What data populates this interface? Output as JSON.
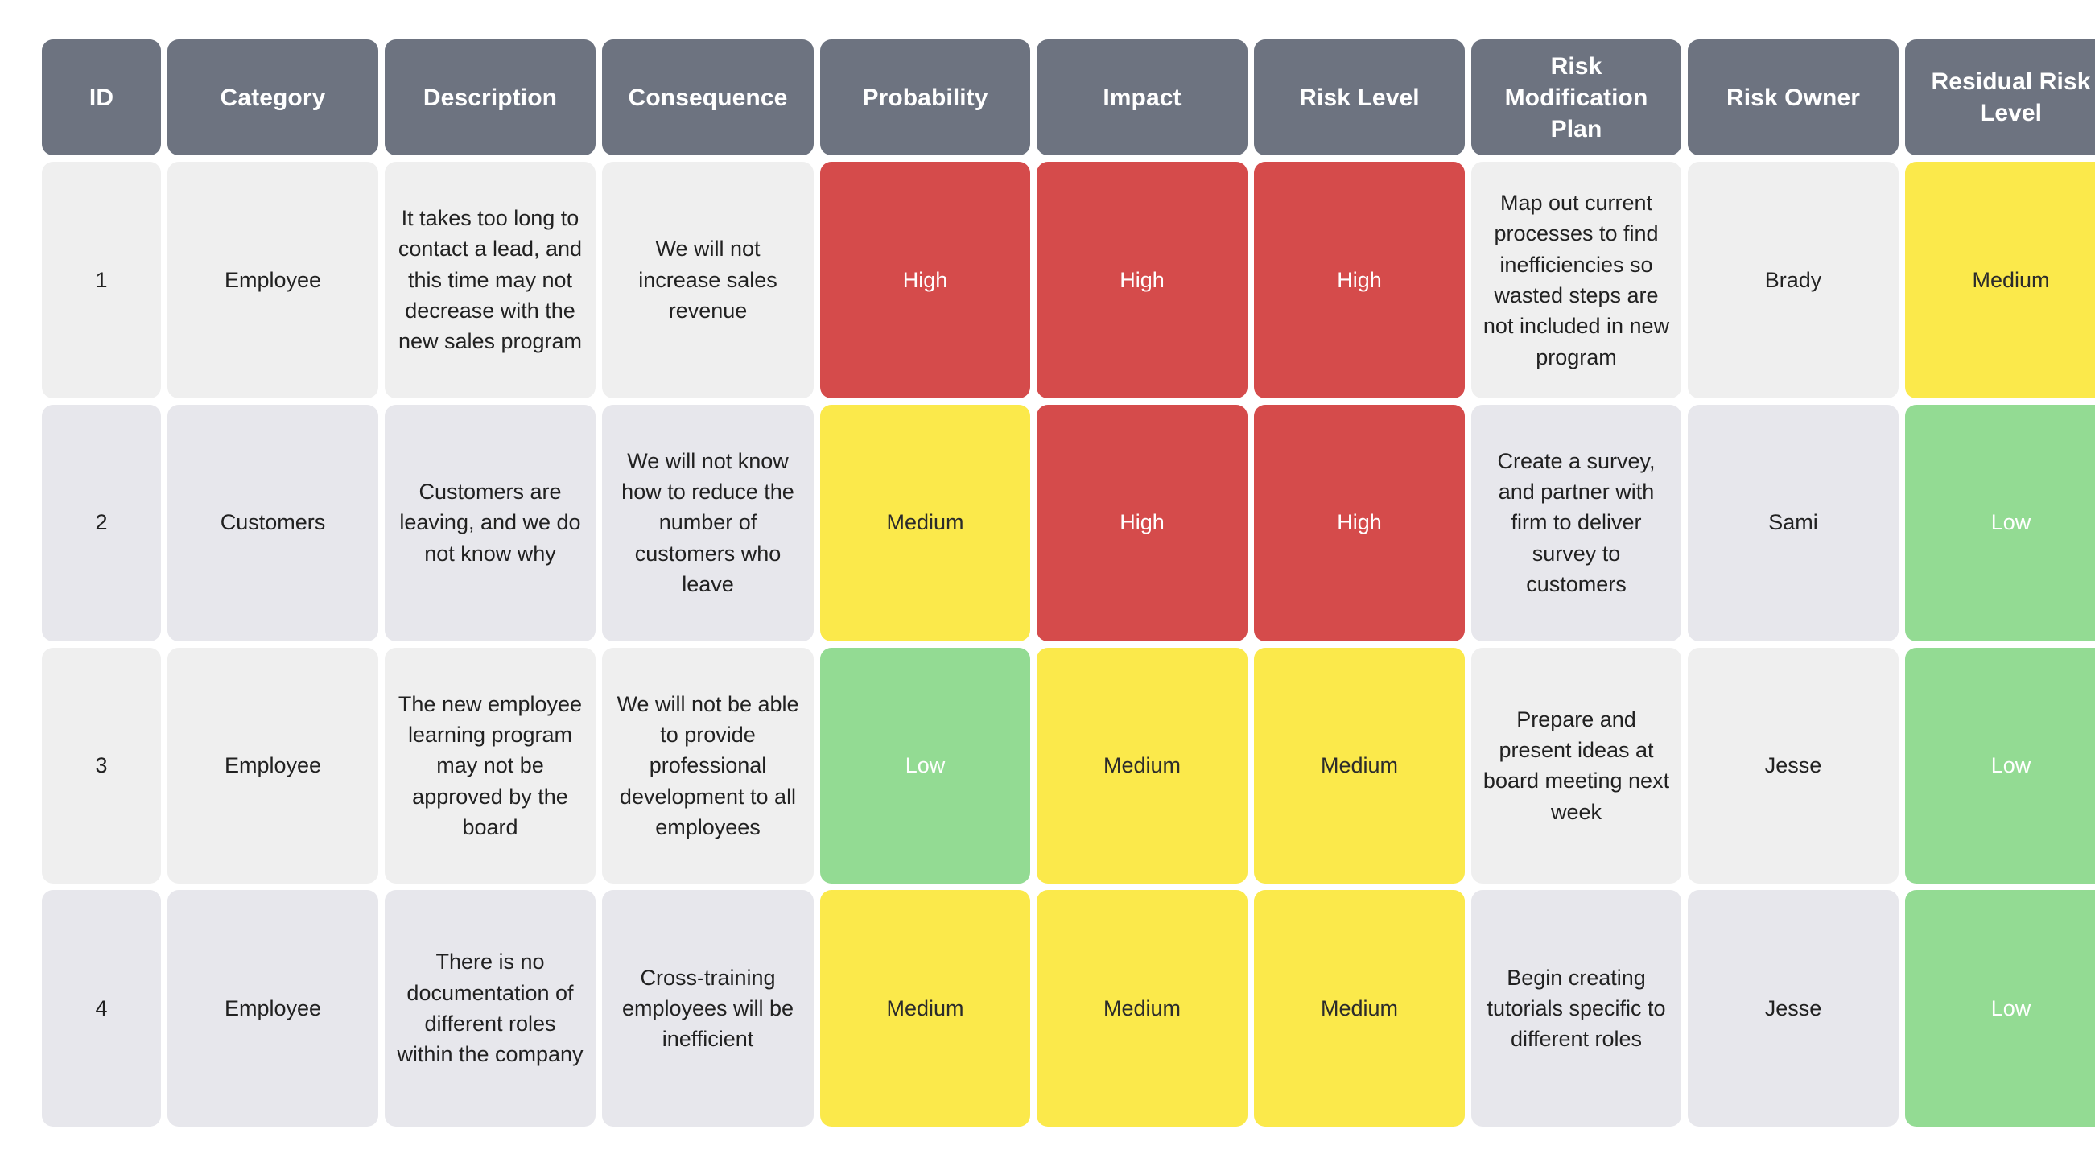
{
  "table": {
    "columns": [
      {
        "key": "id",
        "label": "ID"
      },
      {
        "key": "category",
        "label": "Category"
      },
      {
        "key": "description",
        "label": "Description"
      },
      {
        "key": "consequence",
        "label": "Consequence"
      },
      {
        "key": "probability",
        "label": "Probability"
      },
      {
        "key": "impact",
        "label": "Impact"
      },
      {
        "key": "risk_level",
        "label": "Risk Level"
      },
      {
        "key": "plan",
        "label": "Risk Modification Plan"
      },
      {
        "key": "owner",
        "label": "Risk Owner"
      },
      {
        "key": "residual",
        "label": "Residual Risk Level"
      }
    ],
    "rows": [
      {
        "id": "1",
        "category": "Employee",
        "description": "It takes too long to contact a lead, and this time may not decrease with the new sales program",
        "consequence": "We will not increase sales revenue",
        "probability": "High",
        "impact": "High",
        "risk_level": "High",
        "plan": "Map out current processes to find inefficiencies so wasted steps are not included in new program",
        "owner": "Brady",
        "residual": "Medium"
      },
      {
        "id": "2",
        "category": "Customers",
        "description": "Customers are leaving, and we do not know why",
        "consequence": "We will not know how to reduce the number of customers who leave",
        "probability": "Medium",
        "impact": "High",
        "risk_level": "High",
        "plan": "Create a survey, and partner with firm to deliver survey to customers",
        "owner": "Sami",
        "residual": "Low"
      },
      {
        "id": "3",
        "category": "Employee",
        "description": "The new employee learning program may not be approved by the board",
        "consequence": "We will not be able to provide professional development to all employees",
        "probability": "Low",
        "impact": "Medium",
        "risk_level": "Medium",
        "plan": "Prepare and present ideas at board meeting next week",
        "owner": "Jesse",
        "residual": "Low"
      },
      {
        "id": "4",
        "category": "Employee",
        "description": "There is no documentation of different roles within the company",
        "consequence": "Cross-training employees will be inefficient",
        "probability": "Medium",
        "impact": "Medium",
        "risk_level": "Medium",
        "plan": "Begin creating tutorials specific to different roles",
        "owner": "Jesse",
        "residual": "Low"
      }
    ]
  },
  "colors": {
    "header_background": "#6d7380",
    "header_text": "#ffffff",
    "row_odd_background": "#efefef",
    "row_even_background": "#e7e7ec",
    "level_high": "#d54b4b",
    "level_medium": "#fbe94b",
    "level_low": "#93db93",
    "page_background": "#ffffff"
  }
}
